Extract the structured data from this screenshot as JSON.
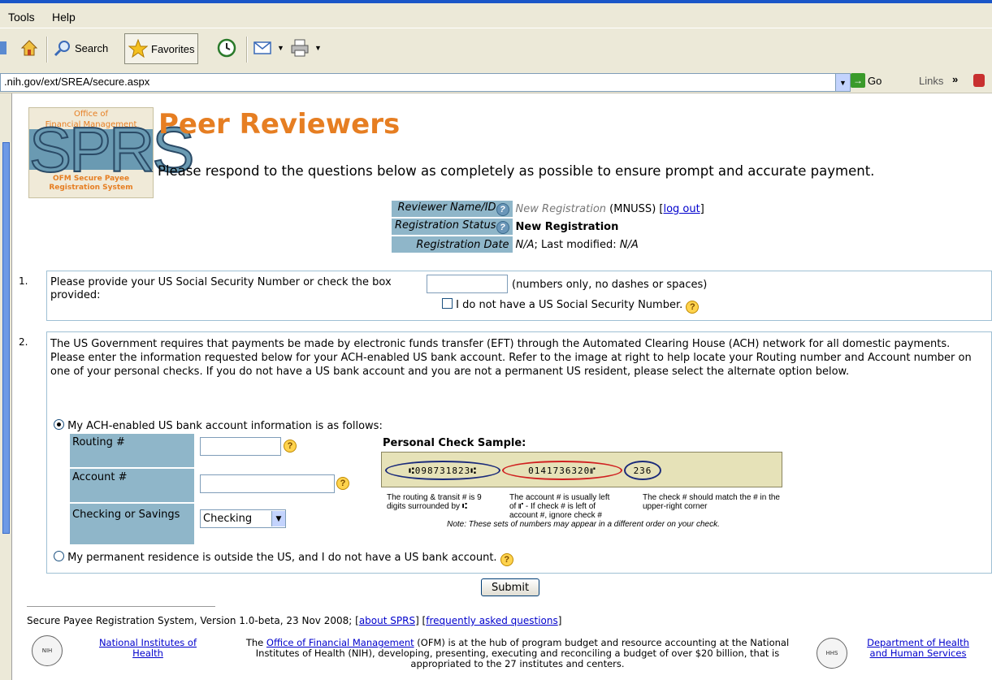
{
  "browser": {
    "menu": [
      "Tools",
      "Help"
    ],
    "toolbar": {
      "search_label": "Search",
      "favorites_label": "Favorites"
    },
    "address": {
      "url": ".nih.gov/ext/SREA/secure.aspx",
      "go_label": "Go",
      "links_label": "Links",
      "more_label": "»"
    }
  },
  "logo": {
    "line1": "Office of",
    "line2": "Financial Management",
    "acronym": "SPRS",
    "line3": "OFM Secure Payee",
    "line4": "Registration System"
  },
  "page": {
    "title": "Peer Reviewers",
    "intro": "Please respond to the questions below as completely as possible to ensure prompt and accurate payment."
  },
  "status": {
    "reviewer_label": "Reviewer Name/ID",
    "reviewer_value": "New Registration",
    "reviewer_code": "(MNUSS)",
    "logout_label": "log out",
    "status_label": "Registration Status",
    "status_value": "New Registration",
    "date_label": "Registration Date",
    "date_value": "N/A",
    "last_modified_label": "; Last modified:",
    "last_modified_value": "N/A"
  },
  "q1": {
    "number": "1.",
    "prompt": "Please provide your US Social Security Number or check the box provided:",
    "hint": "(numbers only, no dashes or spaces)",
    "no_ssn_label": "I do not have a US Social Security Number."
  },
  "q2": {
    "number": "2.",
    "text": "The US Government requires that payments be made by electronic funds transfer (EFT) through the Automated Clearing House (ACH) network for all domestic payments. Please enter the information requested below for your ACH-enabled US bank account. Refer to the image at right to help locate your Routing number and Account number on one of your personal checks. If you do not have a US bank account and you are not a permanent US resident, please select the alternate option below.",
    "option_bank": "My ACH-enabled US bank account information is as follows:",
    "routing_label": "Routing #",
    "account_label": "Account #",
    "type_label": "Checking or Savings",
    "type_value": "Checking",
    "check_title": "Personal Check Sample:",
    "check_routing": "⑆098731823⑆",
    "check_account": "0141736320⑈",
    "check_number": "236",
    "cap_routing": "The routing & transit # is 9 digits surrounded by ⑆",
    "cap_account": "The account # is usually left of ⑈ - If check # is left of account #, ignore check #",
    "cap_check": "The check # should match the # in the upper-right corner",
    "cap_note": "Note: These sets of numbers may appear in a different order on your check.",
    "option_foreign": "My permanent residence is outside the US, and I do not have a US bank account."
  },
  "submit_label": "Submit",
  "footer": {
    "version": "Secure Payee Registration System, Version 1.0-beta, 23 Nov 2008;",
    "about_label": "about SPRS",
    "faq_label": "frequently asked questions",
    "nih_link": "National Institutes of Health",
    "ofm_pre": "The",
    "ofm_link": "Office of Financial Management",
    "ofm_post": "(OFM) is at the hub of program budget and resource accounting at the National Institutes of Health (NIH), developing, presenting, executing and reconciling a budget of over $20 billion, that is appropriated to the 27 institutes and centers.",
    "hhs_link": "Department of Health and Human Services"
  },
  "colors": {
    "accent": "#e67e22",
    "label_bg": "#8fb6c9",
    "link": "#0000cc"
  }
}
